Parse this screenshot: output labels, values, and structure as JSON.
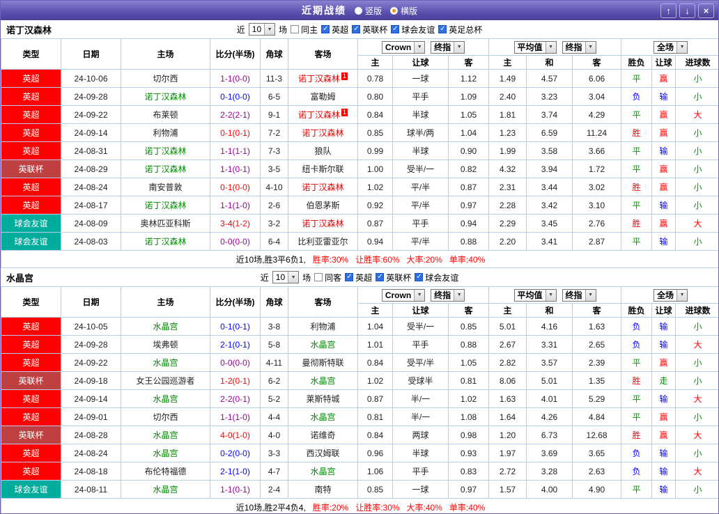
{
  "titlebar": {
    "title": "近期战绩",
    "radio_vertical": "竖版",
    "radio_horizontal": "横版",
    "selected": "横版"
  },
  "icons": {
    "dropdown": "▼",
    "up": "↑",
    "down": "↓",
    "close": "×"
  },
  "filters": {
    "near_label": "近",
    "games_label": "场"
  },
  "table_headers": {
    "type": "类型",
    "date": "日期",
    "home": "主场",
    "score": "比分(半场)",
    "corners": "角球",
    "away": "客场",
    "asian_select1": "Crown",
    "asian_select2": "终指",
    "euro_select1": "平均值",
    "euro_select2": "终指",
    "result_select": "全场",
    "sub": [
      "主",
      "让球",
      "客",
      "主",
      "和",
      "客",
      "胜负",
      "让球",
      "进球数"
    ]
  },
  "sections": [
    {
      "team": "诺丁汉森林",
      "filter": {
        "count": "10",
        "venue_label": "同主",
        "venue_checked": false,
        "leagues": [
          {
            "label": "英超",
            "checked": true
          },
          {
            "label": "英联杯",
            "checked": true
          },
          {
            "label": "球会友谊",
            "checked": true
          },
          {
            "label": "英足总杯",
            "checked": true
          }
        ]
      },
      "rows": [
        {
          "league": "英超",
          "date": "24-10-06",
          "home": "切尔西",
          "home_hl": "",
          "score": "1-1(0-0)",
          "result": "draw",
          "corners": "11-3",
          "away": "诺丁汉森林",
          "away_hl": "red",
          "away_badge": "1",
          "odds_asian": [
            "0.78",
            "一球",
            "1.12"
          ],
          "odds_euro": [
            "1.49",
            "4.57",
            "6.06"
          ],
          "fulltime": "平",
          "fulltime_res": "draw",
          "handicap": "赢",
          "handicap_res": "win",
          "goals": "小",
          "goals_res": "small"
        },
        {
          "league": "英超",
          "date": "24-09-28",
          "home": "诺丁汉森林",
          "home_hl": "green",
          "score": "0-1(0-0)",
          "result": "loss",
          "corners": "6-5",
          "away": "富勒姆",
          "away_hl": "",
          "odds_asian": [
            "0.80",
            "平手",
            "1.09"
          ],
          "odds_euro": [
            "2.40",
            "3.23",
            "3.04"
          ],
          "fulltime": "负",
          "fulltime_res": "loss",
          "handicap": "输",
          "handicap_res": "loss",
          "goals": "小",
          "goals_res": "small"
        },
        {
          "league": "英超",
          "date": "24-09-22",
          "home": "布莱顿",
          "home_hl": "",
          "score": "2-2(2-1)",
          "result": "draw",
          "corners": "9-1",
          "away": "诺丁汉森林",
          "away_hl": "red",
          "away_badge": "1",
          "odds_asian": [
            "0.84",
            "半球",
            "1.05"
          ],
          "odds_euro": [
            "1.81",
            "3.74",
            "4.29"
          ],
          "fulltime": "平",
          "fulltime_res": "draw",
          "handicap": "赢",
          "handicap_res": "win",
          "goals": "大",
          "goals_res": "big"
        },
        {
          "league": "英超",
          "date": "24-09-14",
          "home": "利物浦",
          "home_hl": "",
          "score": "0-1(0-1)",
          "result": "win",
          "corners": "7-2",
          "away": "诺丁汉森林",
          "away_hl": "red",
          "odds_asian": [
            "0.85",
            "球半/两",
            "1.04"
          ],
          "odds_euro": [
            "1.23",
            "6.59",
            "11.24"
          ],
          "fulltime": "胜",
          "fulltime_res": "win",
          "handicap": "赢",
          "handicap_res": "win",
          "goals": "小",
          "goals_res": "small"
        },
        {
          "league": "英超",
          "date": "24-08-31",
          "home": "诺丁汉森林",
          "home_hl": "green",
          "score": "1-1(1-1)",
          "result": "draw",
          "corners": "7-3",
          "away": "狼队",
          "away_hl": "",
          "odds_asian": [
            "0.99",
            "半球",
            "0.90"
          ],
          "odds_euro": [
            "1.99",
            "3.58",
            "3.66"
          ],
          "fulltime": "平",
          "fulltime_res": "draw",
          "handicap": "输",
          "handicap_res": "loss",
          "goals": "小",
          "goals_res": "small"
        },
        {
          "league": "英联杯",
          "date": "24-08-29",
          "home": "诺丁汉森林",
          "home_hl": "green",
          "score": "1-1(0-1)",
          "result": "draw",
          "corners": "3-5",
          "away": "纽卡斯尔联",
          "away_hl": "",
          "odds_asian": [
            "1.00",
            "受半/一",
            "0.82"
          ],
          "odds_euro": [
            "4.32",
            "3.94",
            "1.72"
          ],
          "fulltime": "平",
          "fulltime_res": "draw",
          "handicap": "赢",
          "handicap_res": "win",
          "goals": "小",
          "goals_res": "small"
        },
        {
          "league": "英超",
          "date": "24-08-24",
          "home": "南安普敦",
          "home_hl": "",
          "score": "0-1(0-0)",
          "result": "win",
          "corners": "4-10",
          "away": "诺丁汉森林",
          "away_hl": "red",
          "odds_asian": [
            "1.02",
            "平/半",
            "0.87"
          ],
          "odds_euro": [
            "2.31",
            "3.44",
            "3.02"
          ],
          "fulltime": "胜",
          "fulltime_res": "win",
          "handicap": "赢",
          "handicap_res": "win",
          "goals": "小",
          "goals_res": "small"
        },
        {
          "league": "英超",
          "date": "24-08-17",
          "home": "诺丁汉森林",
          "home_hl": "green",
          "score": "1-1(1-0)",
          "result": "draw",
          "corners": "2-6",
          "away": "伯恩茅斯",
          "away_hl": "",
          "odds_asian": [
            "0.92",
            "平/半",
            "0.97"
          ],
          "odds_euro": [
            "2.28",
            "3.42",
            "3.10"
          ],
          "fulltime": "平",
          "fulltime_res": "draw",
          "handicap": "输",
          "handicap_res": "loss",
          "goals": "小",
          "goals_res": "small"
        },
        {
          "league": "球会友谊",
          "date": "24-08-09",
          "home": "奥林匹亚科斯",
          "home_hl": "",
          "score": "3-4(1-2)",
          "result": "win",
          "corners": "3-2",
          "away": "诺丁汉森林",
          "away_hl": "red",
          "odds_asian": [
            "0.87",
            "平手",
            "0.94"
          ],
          "odds_euro": [
            "2.29",
            "3.45",
            "2.76"
          ],
          "fulltime": "胜",
          "fulltime_res": "win",
          "handicap": "赢",
          "handicap_res": "win",
          "goals": "大",
          "goals_res": "big"
        },
        {
          "league": "球会友谊",
          "date": "24-08-03",
          "home": "诺丁汉森林",
          "home_hl": "green",
          "score": "0-0(0-0)",
          "result": "draw",
          "corners": "6-4",
          "away": "比利亚雷亚尔",
          "away_hl": "",
          "odds_asian": [
            "0.94",
            "平/半",
            "0.88"
          ],
          "odds_euro": [
            "2.20",
            "3.41",
            "2.87"
          ],
          "fulltime": "平",
          "fulltime_res": "draw",
          "handicap": "输",
          "handicap_res": "loss",
          "goals": "小",
          "goals_res": "small"
        }
      ],
      "summary": {
        "prefix": "近10场,胜3平6负1,",
        "stats": [
          "胜率:30%",
          "让胜率:60%",
          "大率:20%",
          "单率:40%"
        ]
      }
    },
    {
      "team": "水晶宫",
      "filter": {
        "count": "10",
        "venue_label": "同客",
        "venue_checked": false,
        "leagues": [
          {
            "label": "英超",
            "checked": true
          },
          {
            "label": "英联杯",
            "checked": true
          },
          {
            "label": "球会友谊",
            "checked": true
          }
        ]
      },
      "rows": [
        {
          "league": "英超",
          "date": "24-10-05",
          "home": "水晶宫",
          "home_hl": "green",
          "score": "0-1(0-1)",
          "result": "loss",
          "corners": "3-8",
          "away": "利物浦",
          "away_hl": "",
          "odds_asian": [
            "1.04",
            "受半/一",
            "0.85"
          ],
          "odds_euro": [
            "5.01",
            "4.16",
            "1.63"
          ],
          "fulltime": "负",
          "fulltime_res": "loss",
          "handicap": "输",
          "handicap_res": "loss",
          "goals": "小",
          "goals_res": "small"
        },
        {
          "league": "英超",
          "date": "24-09-28",
          "home": "埃弗顿",
          "home_hl": "",
          "score": "2-1(0-1)",
          "result": "loss",
          "corners": "5-8",
          "away": "水晶宫",
          "away_hl": "green",
          "odds_asian": [
            "1.01",
            "平手",
            "0.88"
          ],
          "odds_euro": [
            "2.67",
            "3.31",
            "2.65"
          ],
          "fulltime": "负",
          "fulltime_res": "loss",
          "handicap": "输",
          "handicap_res": "loss",
          "goals": "大",
          "goals_res": "big"
        },
        {
          "league": "英超",
          "date": "24-09-22",
          "home": "水晶宫",
          "home_hl": "green",
          "score": "0-0(0-0)",
          "result": "draw",
          "corners": "4-11",
          "away": "曼彻斯特联",
          "away_hl": "",
          "odds_asian": [
            "0.84",
            "受平/半",
            "1.05"
          ],
          "odds_euro": [
            "2.82",
            "3.57",
            "2.39"
          ],
          "fulltime": "平",
          "fulltime_res": "draw",
          "handicap": "赢",
          "handicap_res": "win",
          "goals": "小",
          "goals_res": "small"
        },
        {
          "league": "英联杯",
          "date": "24-09-18",
          "home": "女王公园巡游者",
          "home_hl": "",
          "score": "1-2(0-1)",
          "result": "win",
          "corners": "6-2",
          "away": "水晶宫",
          "away_hl": "green",
          "odds_asian": [
            "1.02",
            "受球半",
            "0.81"
          ],
          "odds_euro": [
            "8.06",
            "5.01",
            "1.35"
          ],
          "fulltime": "胜",
          "fulltime_res": "win",
          "handicap": "走",
          "handicap_res": "push",
          "goals": "小",
          "goals_res": "small"
        },
        {
          "league": "英超",
          "date": "24-09-14",
          "home": "水晶宫",
          "home_hl": "green",
          "score": "2-2(0-1)",
          "result": "draw",
          "corners": "5-2",
          "away": "莱斯特城",
          "away_hl": "",
          "odds_asian": [
            "0.87",
            "半/一",
            "1.02"
          ],
          "odds_euro": [
            "1.63",
            "4.01",
            "5.29"
          ],
          "fulltime": "平",
          "fulltime_res": "draw",
          "handicap": "输",
          "handicap_res": "loss",
          "goals": "大",
          "goals_res": "big"
        },
        {
          "league": "英超",
          "date": "24-09-01",
          "home": "切尔西",
          "home_hl": "",
          "score": "1-1(1-0)",
          "result": "draw",
          "corners": "4-4",
          "away": "水晶宫",
          "away_hl": "green",
          "odds_asian": [
            "0.81",
            "半/一",
            "1.08"
          ],
          "odds_euro": [
            "1.64",
            "4.26",
            "4.84"
          ],
          "fulltime": "平",
          "fulltime_res": "draw",
          "handicap": "赢",
          "handicap_res": "win",
          "goals": "小",
          "goals_res": "small"
        },
        {
          "league": "英联杯",
          "date": "24-08-28",
          "home": "水晶宫",
          "home_hl": "green",
          "score": "4-0(1-0)",
          "result": "win",
          "corners": "4-0",
          "away": "诺维奇",
          "away_hl": "",
          "odds_asian": [
            "0.84",
            "两球",
            "0.98"
          ],
          "odds_euro": [
            "1.20",
            "6.73",
            "12.68"
          ],
          "fulltime": "胜",
          "fulltime_res": "win",
          "handicap": "赢",
          "handicap_res": "win",
          "goals": "大",
          "goals_res": "big"
        },
        {
          "league": "英超",
          "date": "24-08-24",
          "home": "水晶宫",
          "home_hl": "green",
          "score": "0-2(0-0)",
          "result": "loss",
          "corners": "3-3",
          "away": "西汉姆联",
          "away_hl": "",
          "odds_asian": [
            "0.96",
            "半球",
            "0.93"
          ],
          "odds_euro": [
            "1.97",
            "3.69",
            "3.65"
          ],
          "fulltime": "负",
          "fulltime_res": "loss",
          "handicap": "输",
          "handicap_res": "loss",
          "goals": "小",
          "goals_res": "small"
        },
        {
          "league": "英超",
          "date": "24-08-18",
          "home": "布伦特福德",
          "home_hl": "",
          "score": "2-1(1-0)",
          "result": "loss",
          "corners": "4-7",
          "away": "水晶宫",
          "away_hl": "green",
          "odds_asian": [
            "1.06",
            "平手",
            "0.83"
          ],
          "odds_euro": [
            "2.72",
            "3.28",
            "2.63"
          ],
          "fulltime": "负",
          "fulltime_res": "loss",
          "handicap": "输",
          "handicap_res": "loss",
          "goals": "大",
          "goals_res": "big"
        },
        {
          "league": "球会友谊",
          "date": "24-08-11",
          "home": "水晶宫",
          "home_hl": "green",
          "score": "1-1(0-1)",
          "result": "draw",
          "corners": "2-4",
          "away": "南特",
          "away_hl": "",
          "odds_asian": [
            "0.85",
            "一球",
            "0.97"
          ],
          "odds_euro": [
            "1.57",
            "4.00",
            "4.90"
          ],
          "fulltime": "平",
          "fulltime_res": "draw",
          "handicap": "输",
          "handicap_res": "loss",
          "goals": "小",
          "goals_res": "small"
        }
      ],
      "summary": {
        "prefix": "近10场,胜2平4负4,",
        "stats": [
          "胜率:20%",
          "让胜率:30%",
          "大率:40%",
          "单率:40%"
        ]
      }
    }
  ]
}
